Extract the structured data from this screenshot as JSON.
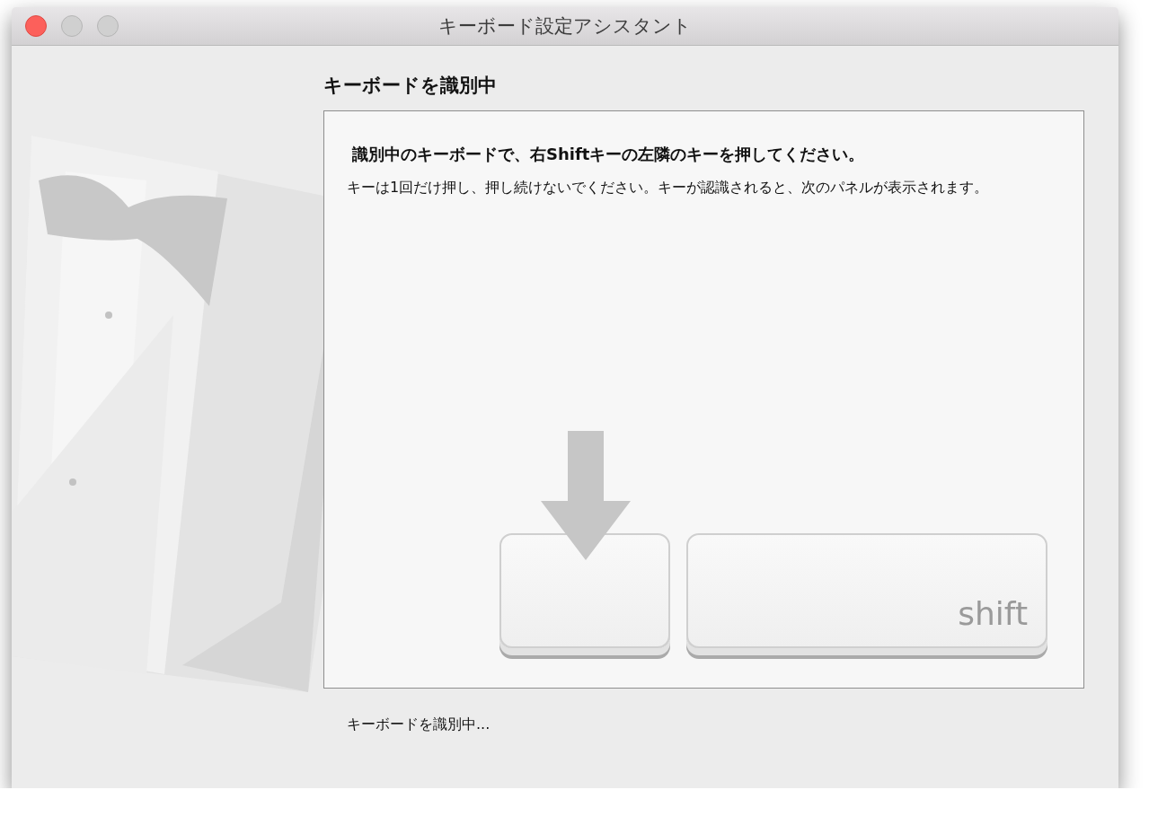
{
  "window": {
    "title": "キーボード設定アシスタント"
  },
  "heading": "キーボードを識別中",
  "panel": {
    "instruction": "識別中のキーボードで、右Shiftキーの左隣のキーを押してください。",
    "description": "キーは1回だけ押し、押し続けないでください。キーが認識されると、次のパネルが表示されます。",
    "keys": [
      {
        "kind": "target"
      },
      {
        "kind": "labeled",
        "label": "shift"
      }
    ]
  },
  "status": "キーボードを識別中..."
}
